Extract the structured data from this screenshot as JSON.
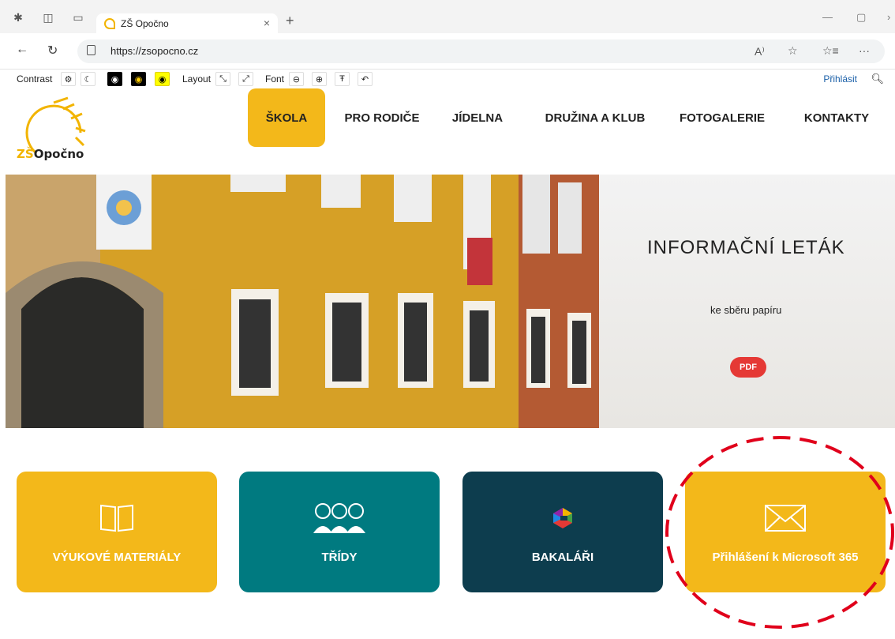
{
  "browser": {
    "tab_title": "ZŠ Opočno",
    "tab_close": "×",
    "new_tab": "+",
    "url": "https://zsopocno.cz",
    "min": "—",
    "max": "▢",
    "read_aloud": "A⁾",
    "more": "···"
  },
  "a11y": {
    "contrast": "Contrast",
    "layout": "Layout",
    "font": "Font",
    "login": "Přihlásit"
  },
  "logo": {
    "zs": "ZŠ",
    "name": "Opočno"
  },
  "nav": {
    "items": [
      "ŠKOLA",
      "PRO RODIČE",
      "JÍDELNA",
      "DRUŽINA A KLUB",
      "FOTOGALERIE",
      "KONTAKTY"
    ],
    "active": "ŠKOLA"
  },
  "hero": {
    "title": "INFORMAČNÍ LETÁK",
    "subtitle": "ke sběru papíru",
    "button": "PDF"
  },
  "tiles": [
    {
      "label": "VÝUKOVÉ MATERIÁLY",
      "color": "#f3b81a",
      "icon": "book-icon"
    },
    {
      "label": "TŘÍDY",
      "color": "#007a80",
      "icon": "people-icon"
    },
    {
      "label": "BAKALÁŘI",
      "color": "#0d3d4e",
      "icon": "bakalari-logo-icon"
    },
    {
      "label": "Přihlášení k Microsoft 365",
      "color": "#f3b81a",
      "icon": "envelope-icon"
    }
  ],
  "annotation_color": "#e0001b"
}
